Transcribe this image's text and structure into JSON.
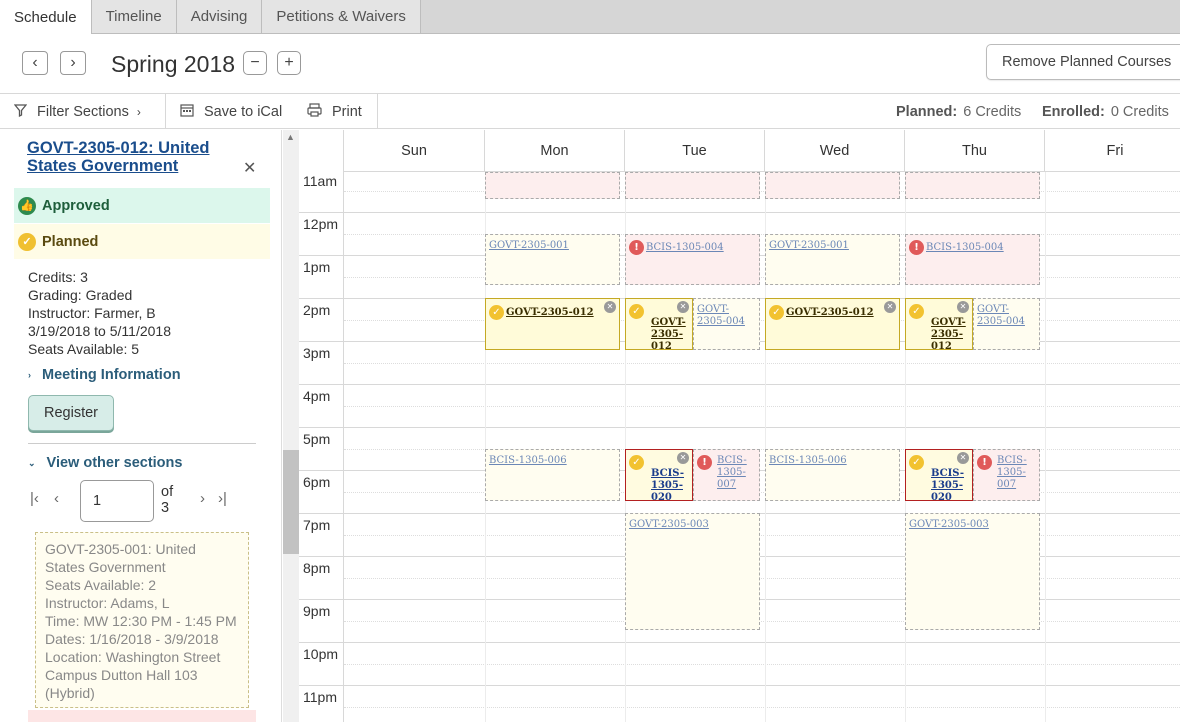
{
  "tabs": [
    "Schedule",
    "Timeline",
    "Advising",
    "Petitions & Waivers"
  ],
  "term": {
    "title": "Spring 2018",
    "prev_icon": "chevron-left-icon",
    "next_icon": "chevron-right-icon",
    "remove_icon": "minus-icon",
    "add_icon": "plus-icon"
  },
  "remove_button": "Remove Planned Courses",
  "toolbar": {
    "filter": "Filter Sections",
    "ical": "Save to iCal",
    "print": "Print"
  },
  "credits": {
    "planned_label": "Planned:",
    "planned_value": "6 Credits",
    "enrolled_label": "Enrolled:",
    "enrolled_value": "0 Credits"
  },
  "sidebar": {
    "course_title": "GOVT-2305-012: United States Government",
    "approved": "Approved",
    "planned": "Planned",
    "details": [
      "Credits: 3",
      "Grading: Graded",
      "Instructor: Farmer, B",
      "3/19/2018 to 5/11/2018",
      "Seats Available:  5"
    ],
    "meeting_info": "Meeting Information",
    "register": "Register",
    "view_other": "View other sections",
    "pager": {
      "value": "1",
      "of": "of 3"
    },
    "other_section": [
      "GOVT-2305-001: United States Government",
      "Seats Available: 2",
      "Instructor: Adams, L",
      "Time: MW 12:30 PM - 1:45 PM",
      "Dates: 1/16/2018 - 3/9/2018",
      "Location: Washington Street Campus Dutton Hall 103 (Hybrid)"
    ]
  },
  "calendar": {
    "days": [
      "Sun",
      "Mon",
      "Tue",
      "Wed",
      "Thu",
      "Fri"
    ],
    "hours": [
      "11am",
      "12pm",
      "1pm",
      "2pm",
      "3pm",
      "4pm",
      "5pm",
      "6pm",
      "7pm",
      "8pm",
      "9pm",
      "10pm",
      "11pm"
    ],
    "events": {
      "govt001": "GOVT-2305-001",
      "bcis004": "BCIS-1305-004",
      "govt012": "GOVT-2305-012",
      "govt004": "GOVT-2305-004",
      "bcis006": "BCIS-1305-006",
      "bcis020": "BCIS-1305-020",
      "bcis007": "BCIS-1305-007",
      "govt003": "GOVT-2305-003"
    }
  }
}
